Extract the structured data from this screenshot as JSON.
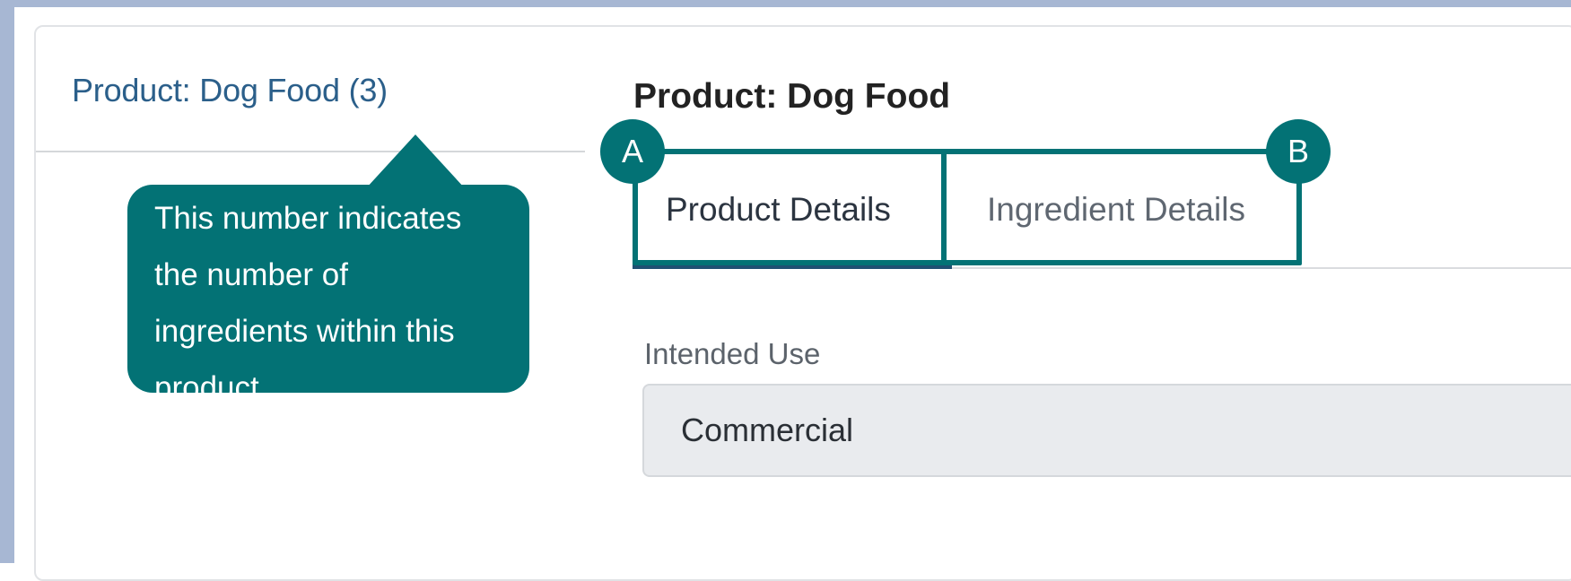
{
  "sidebar": {
    "product_link": "Product: Dog Food (3)"
  },
  "callout": {
    "text": "This number indicates the number of ingredients within this product."
  },
  "main": {
    "title": "Product: Dog Food",
    "tabs": [
      {
        "label": "Product Details",
        "active": true
      },
      {
        "label": "Ingredient Details",
        "active": false
      }
    ],
    "badges": [
      "A",
      "B"
    ],
    "intended_use": {
      "label": "Intended Use",
      "value": "Commercial"
    }
  },
  "colors": {
    "annotation_teal": "#037275",
    "link_blue": "#2b5f8a",
    "active_tab_bar": "#1f4f72"
  }
}
